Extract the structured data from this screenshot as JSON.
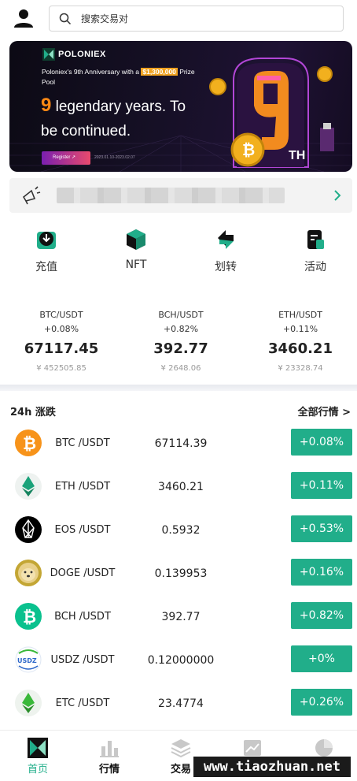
{
  "search": {
    "placeholder": "搜索交易对"
  },
  "banner": {
    "brand": "POLONIEX",
    "anniversary_prefix": "Poloniex's 9th Anniversary with a ",
    "prize_amount": "$1,300,000",
    "anniversary_suffix": " Prize Pool",
    "headline_number": "9",
    "headline_rest": " legendary years. To be continued.",
    "register_label": "Register",
    "date_range": "2023.01.10-2023.02.07",
    "art_glyph": "TH"
  },
  "notice": {
    "text": "████████████████████████"
  },
  "quick_actions": [
    {
      "label": "充值",
      "icon": "deposit-icon"
    },
    {
      "label": "NFT",
      "icon": "nft-icon"
    },
    {
      "label": "划转",
      "icon": "transfer-icon"
    },
    {
      "label": "活动",
      "icon": "activity-icon"
    }
  ],
  "tickers": [
    {
      "pair": "BTC/USDT",
      "change": "+0.08%",
      "price": "67117.45",
      "cny": "¥ 452505.85"
    },
    {
      "pair": "BCH/USDT",
      "change": "+0.82%",
      "price": "392.77",
      "cny": "¥ 2648.06"
    },
    {
      "pair": "ETH/USDT",
      "change": "+0.11%",
      "price": "3460.21",
      "cny": "¥ 23328.74"
    }
  ],
  "market": {
    "title": "24h 涨跌",
    "all_label": "全部行情 >",
    "rows": [
      {
        "pair": "BTC /USDT",
        "price": "67114.39",
        "change": "+0.08%",
        "icon": "btc-icon",
        "color": "#f7931a"
      },
      {
        "pair": "ETH /USDT",
        "price": "3460.21",
        "change": "+0.11%",
        "icon": "eth-icon",
        "color": "#1ba27a"
      },
      {
        "pair": "EOS /USDT",
        "price": "0.5932",
        "change": "+0.53%",
        "icon": "eos-icon",
        "color": "#000000"
      },
      {
        "pair": "DOGE /USDT",
        "price": "0.139953",
        "change": "+0.16%",
        "icon": "doge-icon",
        "color": "#c3a634"
      },
      {
        "pair": "BCH /USDT",
        "price": "392.77",
        "change": "+0.82%",
        "icon": "bch-icon",
        "color": "#0ac18e"
      },
      {
        "pair": "USDZ /USDT",
        "price": "0.12000000",
        "change": "+0%",
        "icon": "usdz-icon",
        "color": "#2b66c9"
      },
      {
        "pair": "ETC /USDT",
        "price": "23.4774",
        "change": "+0.26%",
        "icon": "etc-icon",
        "color": "#3ab83a"
      }
    ]
  },
  "tabs": [
    {
      "label": "首页",
      "icon": "home-icon",
      "active": true
    },
    {
      "label": "行情",
      "icon": "market-icon"
    },
    {
      "label": "交易",
      "icon": "trade-icon"
    },
    {
      "label": "",
      "icon": "chart-icon"
    },
    {
      "label": "",
      "icon": "assets-icon"
    }
  ],
  "watermark": "www.tiaozhuan.net",
  "colors": {
    "accent": "#21ae8a",
    "banner_bg": "#161026",
    "prize_highlight": "#f0a220"
  }
}
